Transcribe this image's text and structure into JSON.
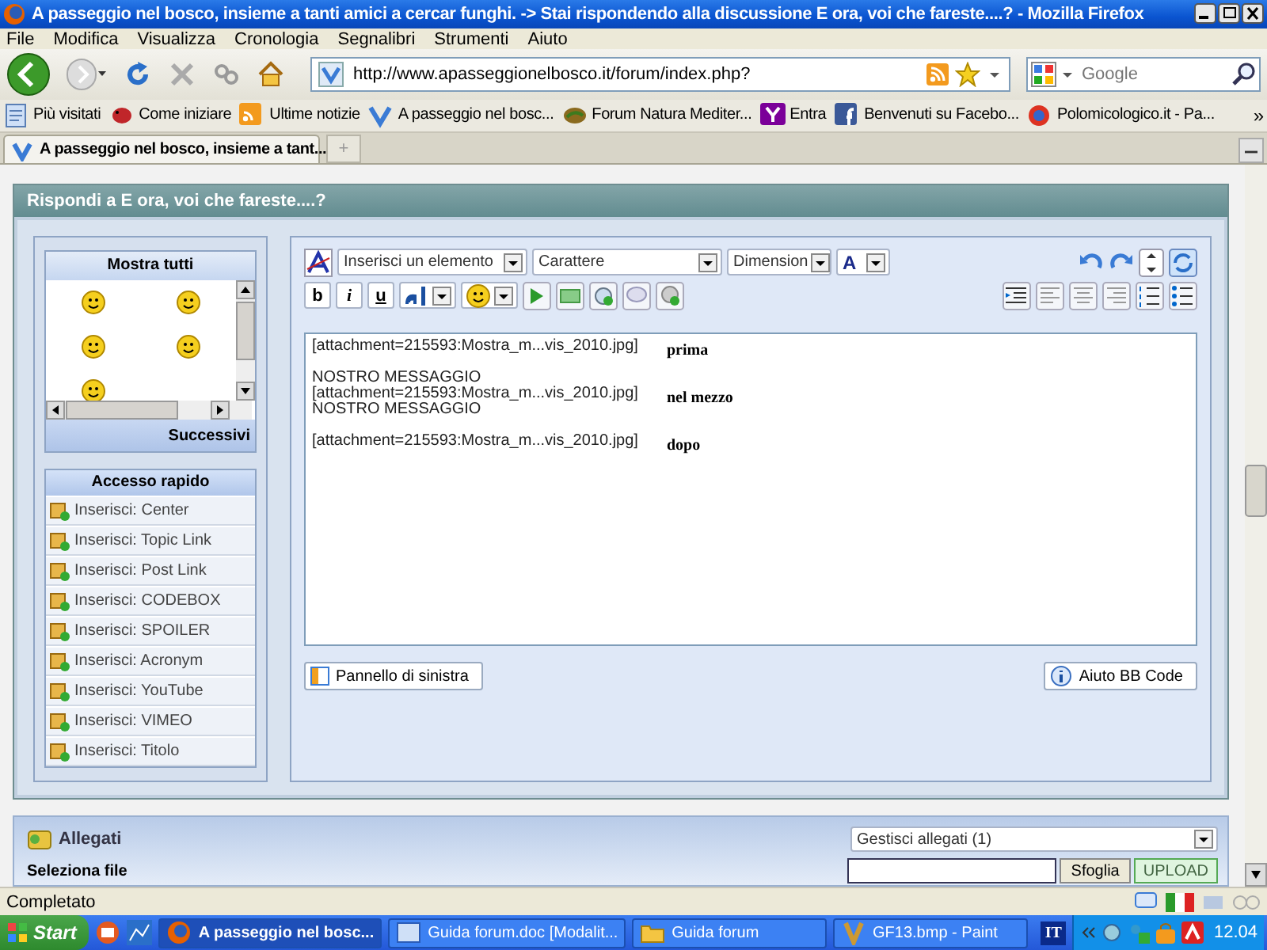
{
  "window": {
    "title": "A passeggio nel bosco, insieme a tanti amici a cercar funghi. -> Stai rispondendo alla discussione E ora, voi che fareste....? - Mozilla Firefox"
  },
  "menu": [
    "File",
    "Modifica",
    "Visualizza",
    "Cronologia",
    "Segnalibri",
    "Strumenti",
    "Aiuto"
  ],
  "navigation": {
    "url": "http://www.apasseggionelbosco.it/forum/index.php?",
    "search_placeholder": "Google"
  },
  "bookmarks": [
    {
      "label": "Più visitati",
      "kind": "page"
    },
    {
      "label": "Come iniziare",
      "kind": "bug"
    },
    {
      "label": "Ultime notizie",
      "kind": "rss"
    },
    {
      "label": "A passeggio nel bosc...",
      "kind": "site"
    },
    {
      "label": "Forum Natura Mediter...",
      "kind": "leaf"
    },
    {
      "label": "Entra",
      "kind": "yahoo"
    },
    {
      "label": "Benvenuti su Facebo...",
      "kind": "facebook"
    },
    {
      "label": "Polomicologico.it - Pa...",
      "kind": "ring"
    }
  ],
  "tabs": [
    {
      "label": "A passeggio nel bosco, insieme a tant...",
      "selected": true
    }
  ],
  "new_tab_button": "+",
  "bookmarks_overflow": "»",
  "reply": {
    "title": "Rispondi a E ora, voi che fareste....?",
    "smileys": {
      "header": "Mostra tutti",
      "footer": "Successivi"
    },
    "quick_access": {
      "title": "Accesso rapido",
      "items": [
        "Inserisci: Center",
        "Inserisci: Topic Link",
        "Inserisci: Post Link",
        "Inserisci: CODEBOX",
        "Inserisci: SPOILER",
        "Inserisci: Acronym",
        "Inserisci: YouTube",
        "Inserisci: VIMEO",
        "Inserisci: Titolo"
      ]
    },
    "editor": {
      "selects": [
        "Inserisci un elemento",
        "Carattere",
        "Dimension"
      ],
      "color_letter": "A",
      "format_buttons": [
        "b",
        "i",
        "u"
      ],
      "lines": [
        {
          "text": "[attachment=215593:Mostra_m...vis_2010.jpg]",
          "note": "prima",
          "gap_after": true
        },
        {
          "text": "NOSTRO MESSAGGIO",
          "gap_after": false
        },
        {
          "text": "[attachment=215593:Mostra_m...vis_2010.jpg]",
          "note": "nel mezzo",
          "gap_after": false
        },
        {
          "text": "NOSTRO MESSAGGIO",
          "gap_after": true
        },
        {
          "text": "[attachment=215593:Mostra_m...vis_2010.jpg]",
          "note": "dopo"
        }
      ],
      "left_panel_button": "Pannello di sinistra",
      "help_button": "Aiuto BB Code"
    }
  },
  "attachments": {
    "title": "Allegati",
    "manage_select": "Gestisci allegati (1)",
    "select_file_label": "Seleziona file",
    "browse_button": "Sfoglia",
    "upload_button": "UPLOAD"
  },
  "status_bar": {
    "text": "Completato"
  },
  "taskbar": {
    "start": "Start",
    "tasks": [
      {
        "label": "A passeggio nel bosc...",
        "selected": true
      },
      {
        "label": "Guida forum.doc [Modalit...",
        "selected": false
      },
      {
        "label": "Guida forum",
        "selected": false
      },
      {
        "label": "GF13.bmp - Paint",
        "selected": false
      }
    ],
    "language": "IT",
    "clock": "12.04"
  }
}
